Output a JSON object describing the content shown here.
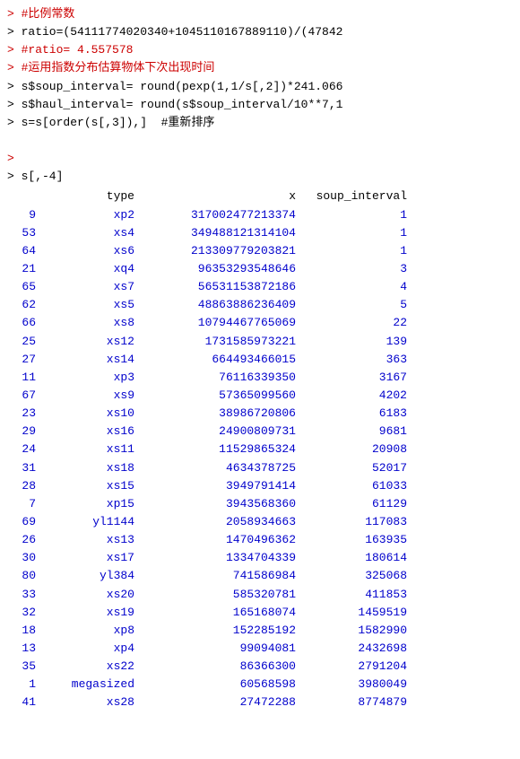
{
  "console": {
    "lines": [
      {
        "type": "comment",
        "text": "> #比例常数"
      },
      {
        "type": "code",
        "text": "> ratio=(54111774020340+1045110167889110)/(47842"
      },
      {
        "type": "comment",
        "text": "> #ratio= 4.557578"
      },
      {
        "type": "comment",
        "text": "> #运用指数分布估算物体下次出现时间"
      },
      {
        "type": "code",
        "text": "> s$soup_interval= round(pexp(1,1/s[,2])*241.066"
      },
      {
        "type": "code",
        "text": "> s$haul_interval= round(s$soup_interval/10**7,1"
      },
      {
        "type": "code",
        "text": "> s=s[order(s[,3]),]  #重新排序"
      }
    ],
    "empty1": "",
    "prompt_line": "> ",
    "cmd_line": "> s[,-4]",
    "header": {
      "index": "",
      "type": "type",
      "x": "x",
      "soup": "soup_interval"
    },
    "rows": [
      {
        "idx": "9",
        "type": "xp2",
        "x": "317002477213374",
        "soup": "1"
      },
      {
        "idx": "53",
        "type": "xs4",
        "x": "349488121314104",
        "soup": "1"
      },
      {
        "idx": "64",
        "type": "xs6",
        "x": "213309779203821",
        "soup": "1"
      },
      {
        "idx": "21",
        "type": "xq4",
        "x": "96353293548646",
        "soup": "3"
      },
      {
        "idx": "65",
        "type": "xs7",
        "x": "56531153872186",
        "soup": "4"
      },
      {
        "idx": "62",
        "type": "xs5",
        "x": "48863886236409",
        "soup": "5"
      },
      {
        "idx": "66",
        "type": "xs8",
        "x": "10794467765069",
        "soup": "22"
      },
      {
        "idx": "25",
        "type": "xs12",
        "x": "1731585973221",
        "soup": "139"
      },
      {
        "idx": "27",
        "type": "xs14",
        "x": "664493466015",
        "soup": "363"
      },
      {
        "idx": "11",
        "type": "xp3",
        "x": "76116339350",
        "soup": "3167"
      },
      {
        "idx": "67",
        "type": "xs9",
        "x": "57365099560",
        "soup": "4202"
      },
      {
        "idx": "23",
        "type": "xs10",
        "x": "38986720806",
        "soup": "6183"
      },
      {
        "idx": "29",
        "type": "xs16",
        "x": "24900809731",
        "soup": "9681"
      },
      {
        "idx": "24",
        "type": "xs11",
        "x": "11529865324",
        "soup": "20908"
      },
      {
        "idx": "31",
        "type": "xs18",
        "x": "4634378725",
        "soup": "52017"
      },
      {
        "idx": "28",
        "type": "xs15",
        "x": "3949791414",
        "soup": "61033"
      },
      {
        "idx": "7",
        "type": "xp15",
        "x": "3943568360",
        "soup": "61129"
      },
      {
        "idx": "69",
        "type": "yl1144",
        "x": "2058934663",
        "soup": "117083"
      },
      {
        "idx": "26",
        "type": "xs13",
        "x": "1470496362",
        "soup": "163935"
      },
      {
        "idx": "30",
        "type": "xs17",
        "x": "1334704339",
        "soup": "180614"
      },
      {
        "idx": "80",
        "type": "yl384",
        "x": "741586984",
        "soup": "325068"
      },
      {
        "idx": "33",
        "type": "xs20",
        "x": "585320781",
        "soup": "411853"
      },
      {
        "idx": "32",
        "type": "xs19",
        "x": "165168074",
        "soup": "1459519"
      },
      {
        "idx": "18",
        "type": "xp8",
        "x": "152285192",
        "soup": "1582990"
      },
      {
        "idx": "13",
        "type": "xp4",
        "x": "99094081",
        "soup": "2432698"
      },
      {
        "idx": "35",
        "type": "xs22",
        "x": "86366300",
        "soup": "2791204"
      },
      {
        "idx": "1",
        "type": "megasized",
        "x": "60568598",
        "soup": "3980049"
      },
      {
        "idx": "41",
        "type": "xs28",
        "x": "27472288",
        "soup": "8774879"
      }
    ]
  }
}
